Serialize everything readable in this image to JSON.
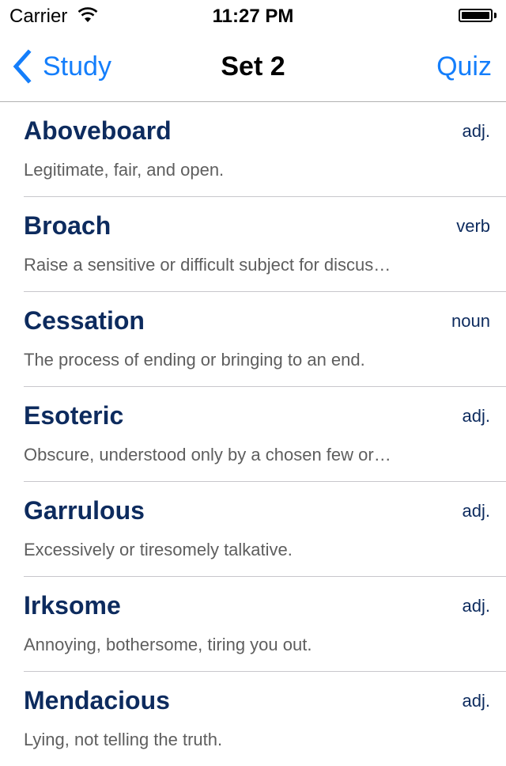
{
  "status_bar": {
    "carrier": "Carrier",
    "time": "11:27 PM",
    "wifi_icon": "wifi-icon",
    "battery_icon": "battery-icon",
    "battery_level": 1.0
  },
  "nav": {
    "back_label": "Study",
    "back_icon": "chevron-left-icon",
    "title": "Set 2",
    "right_label": "Quiz"
  },
  "colors": {
    "accent": "#147efb",
    "word": "#0d2b5e",
    "definition": "#5e5e5e",
    "separator": "#c8c7cc"
  },
  "words": [
    {
      "word": "Aboveboard",
      "pos": "adj.",
      "definition": "Legitimate, fair, and open."
    },
    {
      "word": "Broach",
      "pos": "verb",
      "definition": "Raise a sensitive or difficult subject for discus…"
    },
    {
      "word": "Cessation",
      "pos": "noun",
      "definition": "The process of ending or bringing to an end."
    },
    {
      "word": "Esoteric",
      "pos": "adj.",
      "definition": "Obscure, understood only by a chosen few or…"
    },
    {
      "word": "Garrulous",
      "pos": "adj.",
      "definition": "Excessively or tiresomely talkative."
    },
    {
      "word": "Irksome",
      "pos": "adj.",
      "definition": "Annoying, bothersome, tiring you out."
    },
    {
      "word": "Mendacious",
      "pos": "adj.",
      "definition": "Lying, not telling the truth."
    }
  ]
}
